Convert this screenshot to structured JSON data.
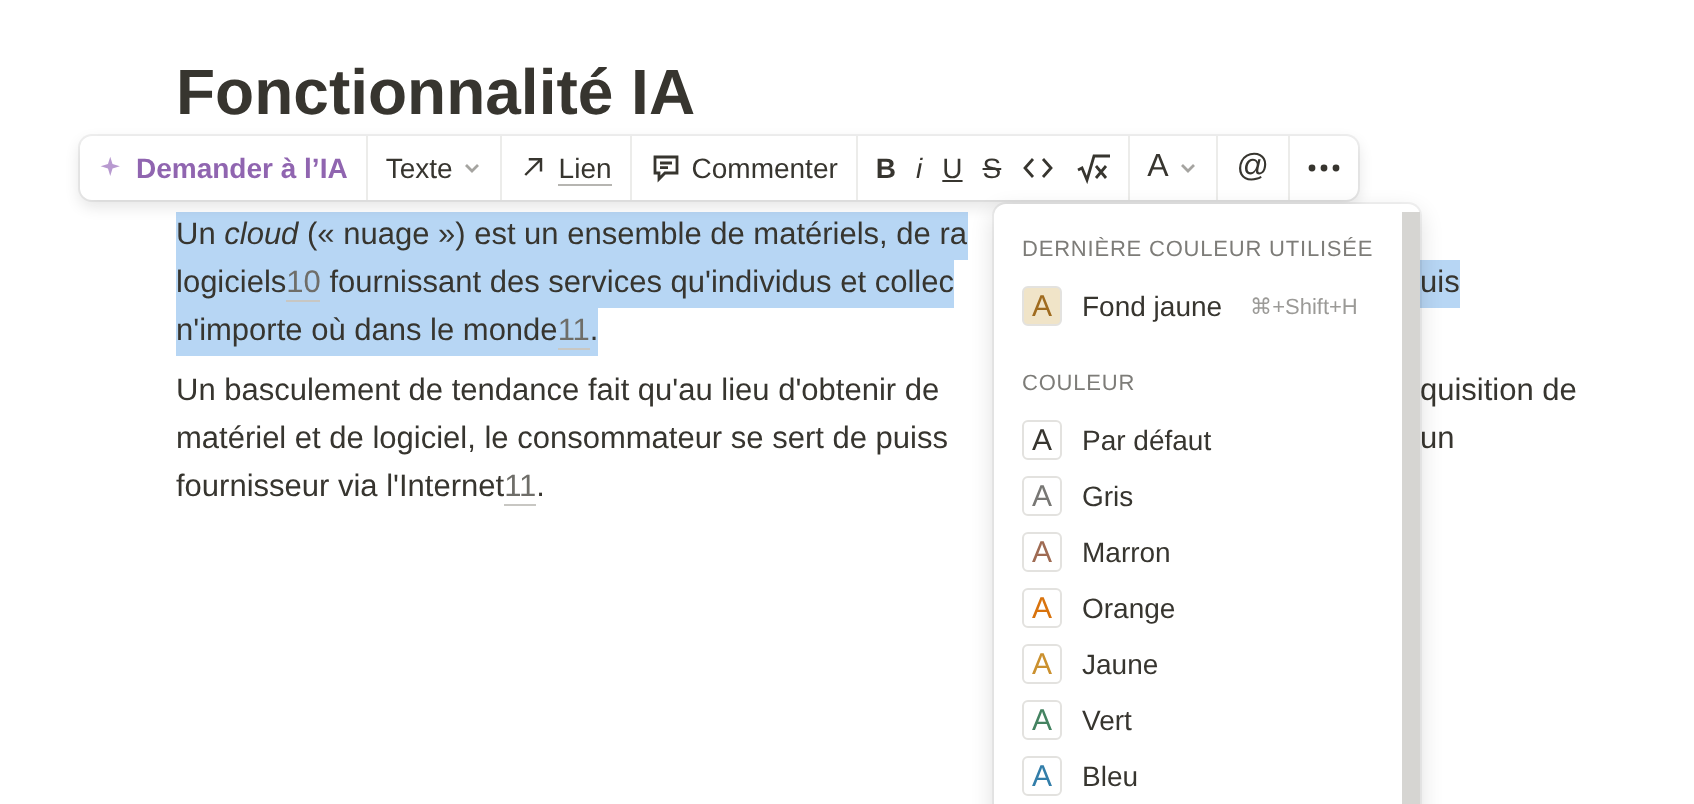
{
  "title": "Fonctionnalité IA",
  "toolbar": [
    {
      "kind": "ai",
      "label": "Demander à l’IA"
    },
    {
      "kind": "dropdown",
      "label": "Texte"
    },
    {
      "kind": "link",
      "label": "Lien"
    },
    {
      "kind": "comment",
      "label": "Commenter"
    },
    {
      "kind": "format",
      "items": [
        {
          "kind": "bold",
          "label": "B"
        },
        {
          "kind": "italic",
          "label": "i"
        },
        {
          "kind": "underline",
          "label": "U"
        },
        {
          "kind": "strike",
          "label": "S"
        },
        {
          "kind": "code"
        },
        {
          "kind": "math"
        }
      ]
    },
    {
      "kind": "color",
      "label": "A"
    },
    {
      "kind": "mention",
      "label": "@"
    },
    {
      "kind": "more"
    }
  ],
  "paragraphs": [
    {
      "lines": [
        {
          "selected": true,
          "left": [
            {
              "kind": "text",
              "text": "Un "
            },
            {
              "kind": "italic",
              "text": "cloud"
            },
            {
              "kind": "text",
              "text": " (« nuage ») est un ensemble de matériels, de ra"
            }
          ]
        },
        {
          "selected": true,
          "left": [
            {
              "kind": "text",
              "text": "logiciels"
            },
            {
              "kind": "ref",
              "text": "10"
            },
            {
              "kind": "text",
              "text": " fournissant des services qu'individus et collec"
            }
          ],
          "right": "uis"
        },
        {
          "selected": true,
          "left": [
            {
              "kind": "text",
              "text": "n'importe où dans le monde"
            },
            {
              "kind": "ref",
              "text": "11"
            },
            {
              "kind": "text",
              "text": "."
            }
          ]
        }
      ]
    },
    {
      "lines": [
        {
          "selected": false,
          "left": [
            {
              "kind": "text",
              "text": "Un basculement de tendance fait qu'au lieu d'obtenir de"
            }
          ],
          "right": "quisition de"
        },
        {
          "selected": false,
          "left": [
            {
              "kind": "text",
              "text": "matériel et de logiciel, le consommateur se sert de puiss"
            }
          ],
          "right": "un"
        },
        {
          "selected": false,
          "left": [
            {
              "kind": "text",
              "text": "fournisseur via l'Internet"
            },
            {
              "kind": "ref",
              "text": "11"
            },
            {
              "kind": "text",
              "text": "."
            }
          ]
        }
      ]
    }
  ],
  "color_menu": {
    "sections": [
      {
        "heading": "DERNIÈRE COULEUR UTILISÉE",
        "items": [
          {
            "label": "Fond jaune",
            "icon": "A",
            "shortcut": "⌘+Shift+H",
            "color": "#9f6b1f",
            "kind": "background"
          }
        ]
      },
      {
        "heading": "COULEUR",
        "items": [
          {
            "label": "Par défaut",
            "icon": "A",
            "color": "#37352f"
          },
          {
            "label": "Gris",
            "icon": "A",
            "color": "#787774"
          },
          {
            "label": "Marron",
            "icon": "A",
            "color": "#9f6b53"
          },
          {
            "label": "Orange",
            "icon": "A",
            "color": "#d9730d"
          },
          {
            "label": "Jaune",
            "icon": "A",
            "color": "#cb912f"
          },
          {
            "label": "Vert",
            "icon": "A",
            "color": "#448361"
          },
          {
            "label": "Bleu",
            "icon": "A",
            "color": "#337ea9"
          }
        ]
      }
    ]
  }
}
